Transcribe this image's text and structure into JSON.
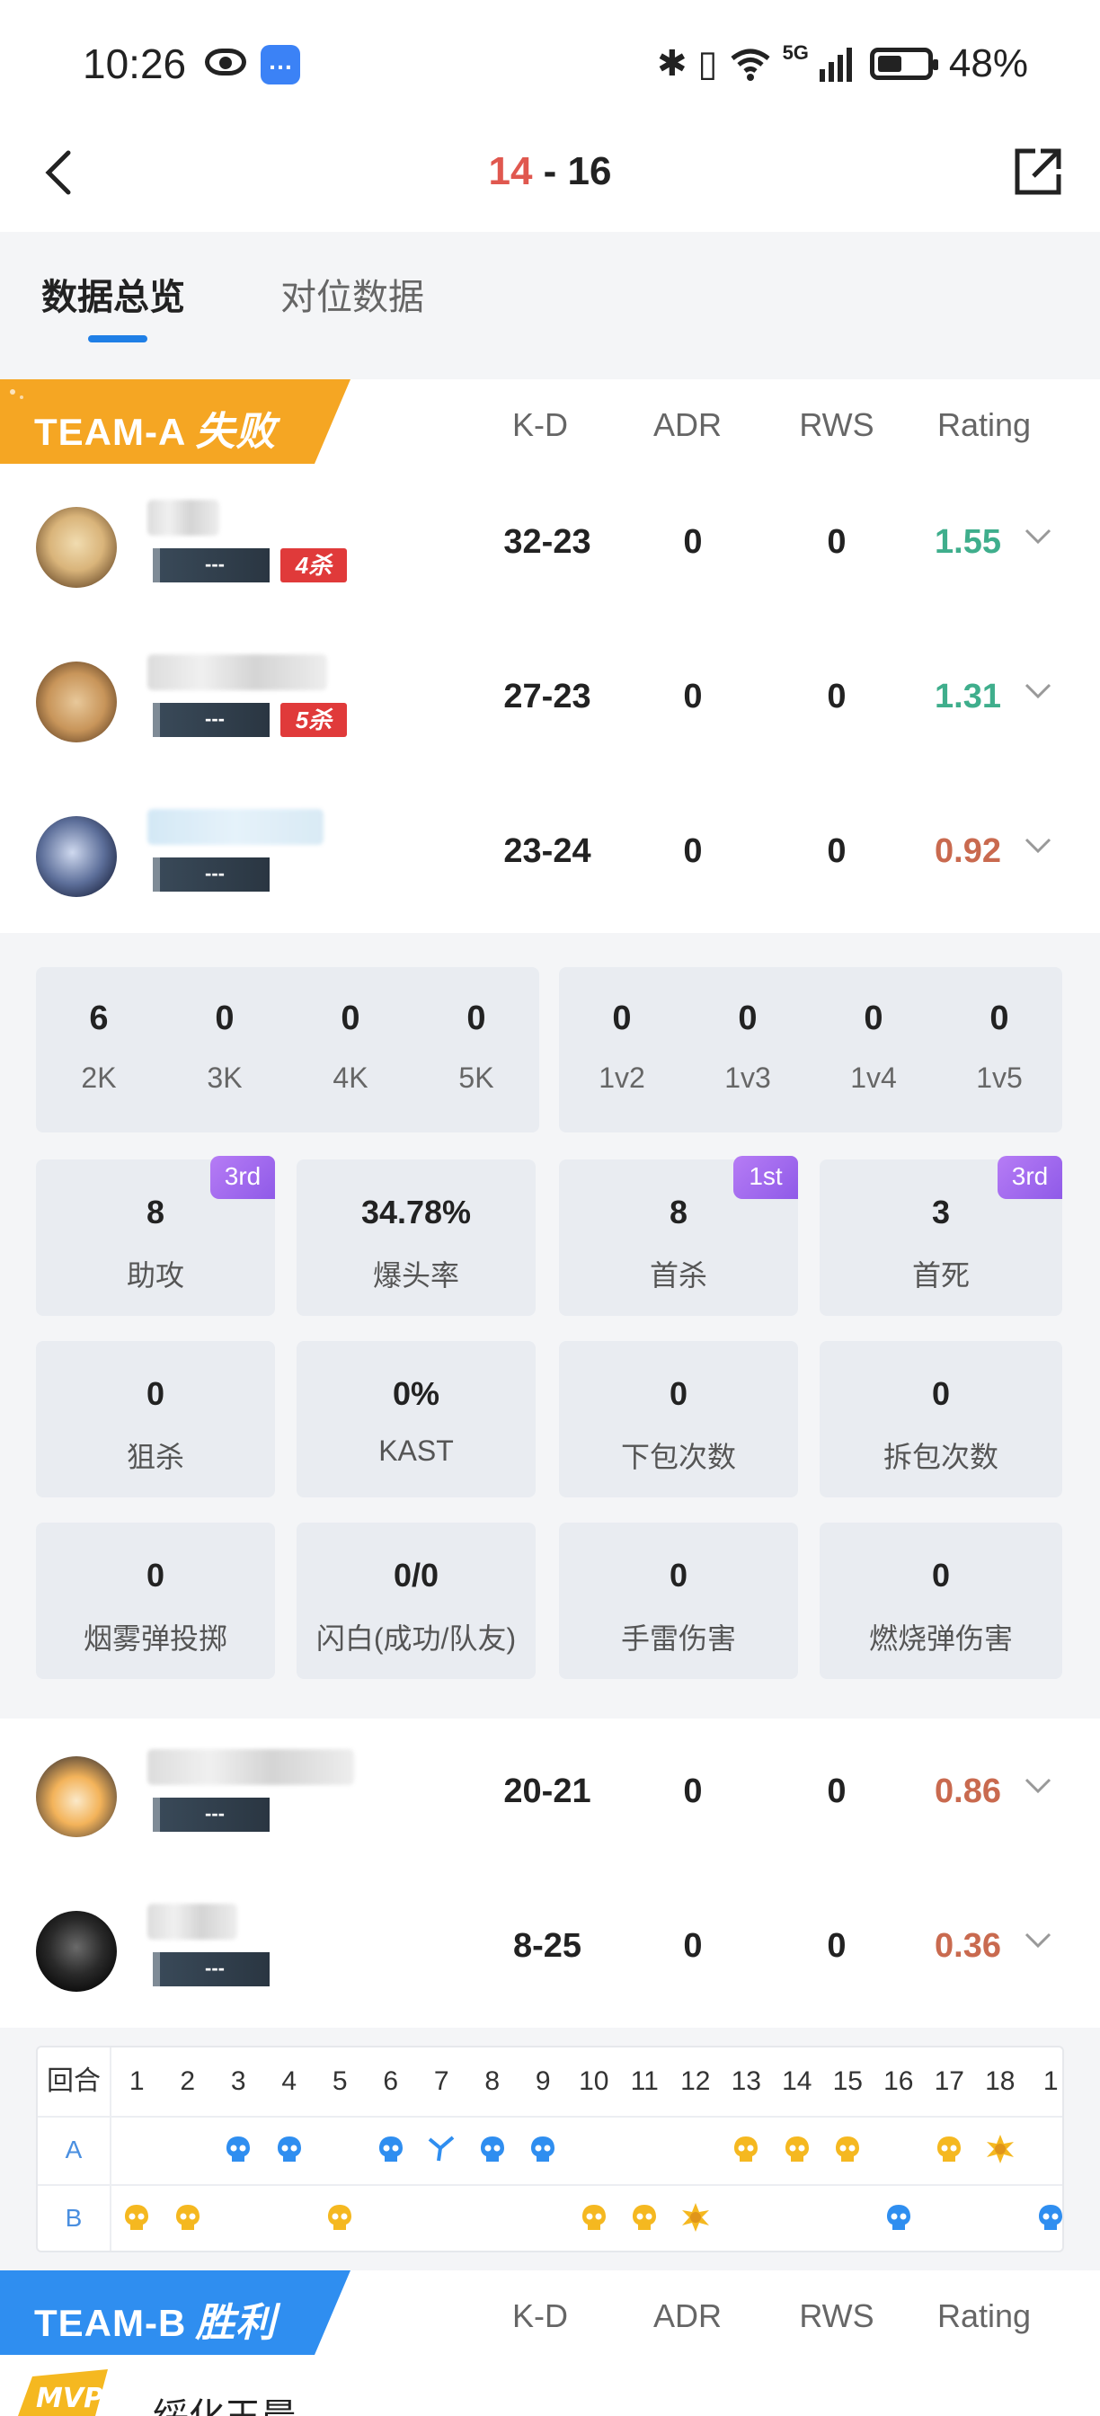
{
  "status_bar": {
    "time": "10:26",
    "msg_icon": "💬",
    "network": "5G",
    "battery": "48%"
  },
  "header": {
    "score_a": "14",
    "score_sep": " - ",
    "score_b": "16"
  },
  "tabs": [
    {
      "label": "数据总览",
      "active": true
    },
    {
      "label": "对位数据",
      "active": false
    }
  ],
  "columns": [
    "K-D",
    "ADR",
    "RWS",
    "Rating"
  ],
  "team_a": {
    "name": "TEAM-A",
    "result": "失败",
    "color": "#f5a623",
    "players": [
      {
        "kd": "32-23",
        "adr": "0",
        "rws": "0",
        "rating": "1.55",
        "rating_class": "good",
        "rank": "---",
        "kill_tag": "4杀"
      },
      {
        "kd": "27-23",
        "adr": "0",
        "rws": "0",
        "rating": "1.31",
        "rating_class": "good",
        "rank": "---",
        "kill_tag": "5杀"
      },
      {
        "kd": "23-24",
        "adr": "0",
        "rws": "0",
        "rating": "0.92",
        "rating_class": "bad",
        "rank": "---",
        "kill_tag": ""
      },
      {
        "kd": "20-21",
        "adr": "0",
        "rws": "0",
        "rating": "0.86",
        "rating_class": "bad",
        "rank": "---",
        "kill_tag": ""
      },
      {
        "kd": "8-25",
        "adr": "0",
        "rws": "0",
        "rating": "0.36",
        "rating_class": "bad",
        "rank": "---",
        "kill_tag": ""
      }
    ]
  },
  "expanded_stats": {
    "multi_kills": [
      {
        "value": "6",
        "label": "2K"
      },
      {
        "value": "0",
        "label": "3K"
      },
      {
        "value": "0",
        "label": "4K"
      },
      {
        "value": "0",
        "label": "5K"
      }
    ],
    "clutches": [
      {
        "value": "0",
        "label": "1v2"
      },
      {
        "value": "0",
        "label": "1v3"
      },
      {
        "value": "0",
        "label": "1v4"
      },
      {
        "value": "0",
        "label": "1v5"
      }
    ],
    "cards": [
      {
        "value": "8",
        "label": "助攻",
        "badge": "3rd"
      },
      {
        "value": "34.78%",
        "label": "爆头率",
        "badge": ""
      },
      {
        "value": "8",
        "label": "首杀",
        "badge": "1st"
      },
      {
        "value": "3",
        "label": "首死",
        "badge": "3rd"
      },
      {
        "value": "0",
        "label": "狙杀",
        "badge": ""
      },
      {
        "value": "0%",
        "label": "KAST",
        "badge": ""
      },
      {
        "value": "0",
        "label": "下包次数",
        "badge": ""
      },
      {
        "value": "0",
        "label": "拆包次数",
        "badge": ""
      },
      {
        "value": "0",
        "label": "烟雾弹投掷",
        "badge": ""
      },
      {
        "value": "0/0",
        "label": "闪白(成功/队友)",
        "badge": ""
      },
      {
        "value": "0",
        "label": "手雷伤害",
        "badge": ""
      },
      {
        "value": "0",
        "label": "燃烧弹伤害",
        "badge": ""
      }
    ]
  },
  "rounds": {
    "header_label": "回合",
    "row_a": "A",
    "row_b": "B",
    "numbers": [
      "1",
      "2",
      "3",
      "4",
      "5",
      "6",
      "7",
      "8",
      "9",
      "10",
      "11",
      "12",
      "13",
      "14",
      "15",
      "16",
      "17",
      "18",
      "1"
    ],
    "a_icons": [
      "",
      "",
      "skull-blue",
      "skull-blue",
      "",
      "skull-blue",
      "defuse-blue",
      "skull-blue",
      "skull-blue",
      "",
      "",
      "",
      "skull-orange",
      "skull-orange",
      "skull-orange",
      "",
      "skull-orange",
      "explode-orange",
      ""
    ],
    "b_icons": [
      "skull-orange",
      "skull-orange",
      "",
      "",
      "skull-orange",
      "",
      "",
      "",
      "",
      "skull-orange",
      "skull-orange",
      "explode-orange",
      "",
      "",
      "",
      "skull-blue",
      "",
      "",
      "skull-blue"
    ]
  },
  "team_b": {
    "name": "TEAM-B",
    "result": "胜利",
    "color": "#2f8ef0",
    "mvp_label": "MVP",
    "first_player_name": "绥化王晨"
  }
}
